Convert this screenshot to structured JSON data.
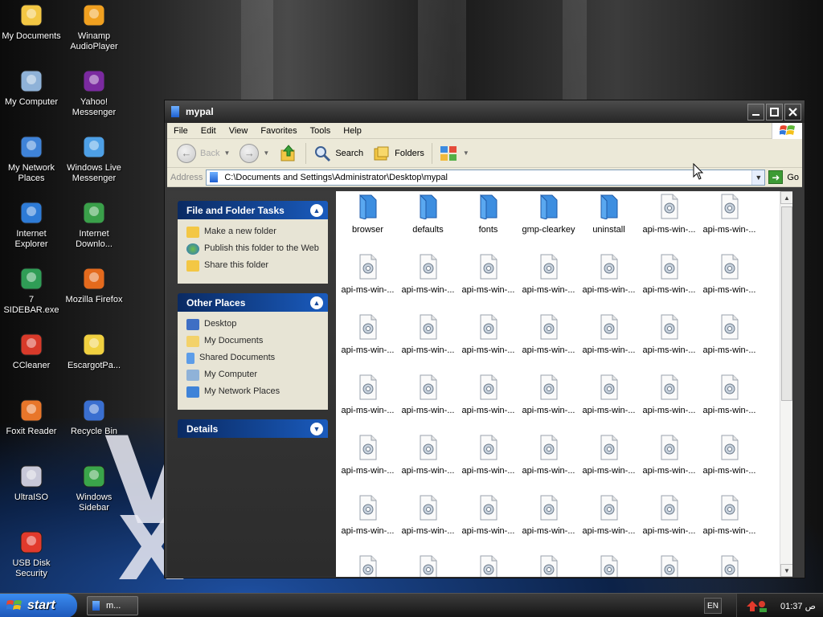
{
  "desktop": {
    "icons": [
      {
        "label": "My Documents",
        "icon": "my-documents-icon"
      },
      {
        "label": "Winamp AudioPlayer",
        "icon": "winamp-icon"
      },
      {
        "label": "My Computer",
        "icon": "my-computer-icon"
      },
      {
        "label": "Yahoo! Messenger",
        "icon": "yahoo-messenger-icon"
      },
      {
        "label": "My Network Places",
        "icon": "network-places-icon"
      },
      {
        "label": "Windows Live Messenger",
        "icon": "live-messenger-icon"
      },
      {
        "label": "Internet Explorer",
        "icon": "internet-explorer-icon"
      },
      {
        "label": "Internet Downlo...",
        "icon": "internet-download-icon"
      },
      {
        "label": "7 SIDEBAR.exe",
        "icon": "sidebar-exe-icon"
      },
      {
        "label": "Mozilla Firefox",
        "icon": "firefox-icon"
      },
      {
        "label": "CCleaner",
        "icon": "ccleaner-icon"
      },
      {
        "label": "EscargotPa...",
        "icon": "escargot-icon"
      },
      {
        "label": "Foxit Reader",
        "icon": "foxit-reader-icon"
      },
      {
        "label": "Recycle Bin",
        "icon": "recycle-bin-icon"
      },
      {
        "label": "UltraISO",
        "icon": "ultraiso-icon"
      },
      {
        "label": "Windows Sidebar",
        "icon": "windows-sidebar-icon"
      },
      {
        "label": "USB Disk Security",
        "icon": "usb-disk-security-icon"
      }
    ]
  },
  "window": {
    "title": "mypal",
    "menu": [
      "File",
      "Edit",
      "View",
      "Favorites",
      "Tools",
      "Help"
    ],
    "toolbar": {
      "back": "Back",
      "search": "Search",
      "folders": "Folders"
    },
    "address": {
      "label": "Address",
      "path": "C:\\Documents and Settings\\Administrator\\Desktop\\mypal",
      "go": "Go"
    },
    "tasks_panel": {
      "title": "File and Folder Tasks",
      "items": [
        "Make a new folder",
        "Publish this folder to the Web",
        "Share this folder"
      ]
    },
    "other_places_panel": {
      "title": "Other Places",
      "items": [
        "Desktop",
        "My Documents",
        "Shared Documents",
        "My Computer",
        "My Network Places"
      ]
    },
    "details_panel": {
      "title": "Details"
    },
    "files": [
      "browser",
      "defaults",
      "fonts",
      "gmp-clearkey",
      "uninstall",
      "api-ms-win-...",
      "api-ms-win-...",
      "api-ms-win-...",
      "api-ms-win-...",
      "api-ms-win-...",
      "api-ms-win-...",
      "api-ms-win-...",
      "api-ms-win-...",
      "api-ms-win-...",
      "api-ms-win-...",
      "api-ms-win-...",
      "api-ms-win-...",
      "api-ms-win-...",
      "api-ms-win-...",
      "api-ms-win-...",
      "api-ms-win-...",
      "api-ms-win-...",
      "api-ms-win-...",
      "api-ms-win-...",
      "api-ms-win-...",
      "api-ms-win-...",
      "api-ms-win-...",
      "api-ms-win-...",
      "api-ms-win-...",
      "api-ms-win-...",
      "api-ms-win-...",
      "api-ms-win-...",
      "api-ms-win-...",
      "api-ms-win-...",
      "api-ms-win-...",
      "api-ms-win-...",
      "api-ms-win-...",
      "api-ms-win-...",
      "api-ms-win-...",
      "api-ms-win-...",
      "api-ms-win-...",
      "api-ms-win-..."
    ]
  },
  "taskbar": {
    "start": "start",
    "task_item": "m...",
    "language": "EN",
    "time": "01:37 ص"
  }
}
